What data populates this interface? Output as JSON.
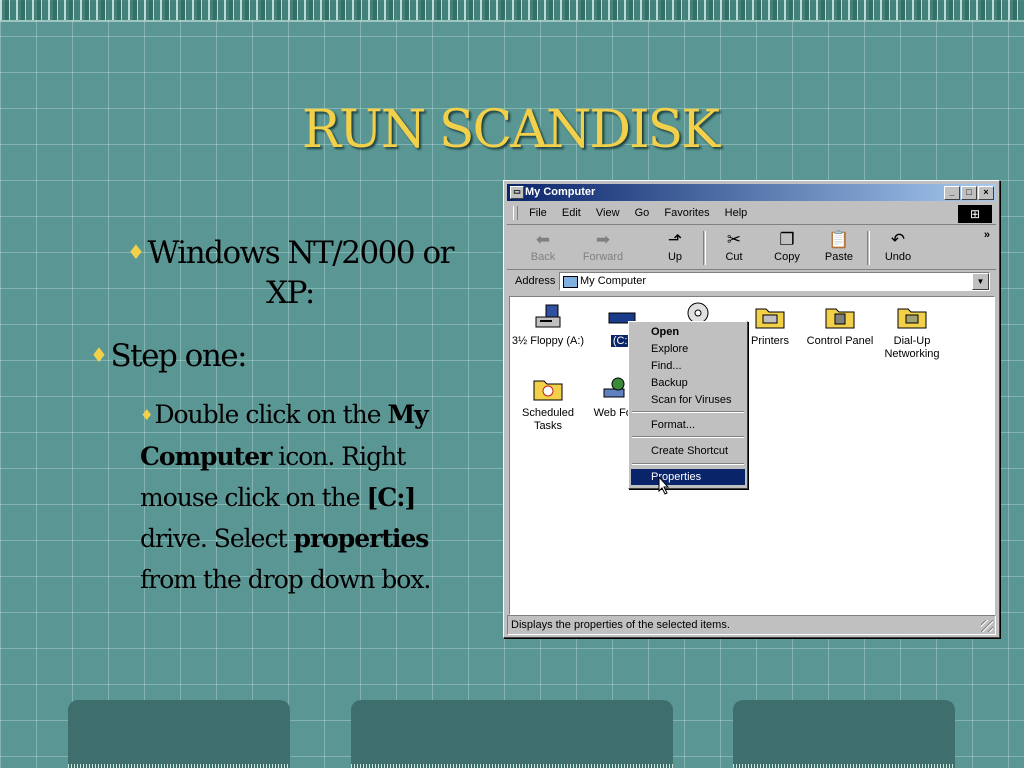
{
  "slide": {
    "title": "RUN SCANDISK",
    "bullet1": "Windows NT/2000 or XP:",
    "bullet2": "Step one:",
    "sub": {
      "p1": "Double click on the ",
      "b1": "My Computer",
      "p2": " icon. Right mouse click on the ",
      "b2": "[C:]",
      "p3": " drive. Select ",
      "b3": "properties",
      "p4": " from the drop down box."
    }
  },
  "window": {
    "title": "My Computer",
    "menu": [
      "File",
      "Edit",
      "View",
      "Go",
      "Favorites",
      "Help"
    ],
    "toolbar": {
      "back": "Back",
      "forward": "Forward",
      "up": "Up",
      "cut": "Cut",
      "copy": "Copy",
      "paste": "Paste",
      "undo": "Undo"
    },
    "address_label": "Address",
    "address_value": "My Computer",
    "items": {
      "floppy": "3½ Floppy (A:)",
      "c_drive": "(C:)",
      "printers": "Printers",
      "control_panel": "Control Panel",
      "dialup": "Dial-Up Networking",
      "scheduled": "Scheduled Tasks",
      "webfolders": "Web Fol"
    },
    "status": "Displays the properties of the selected items."
  },
  "context_menu": {
    "open": "Open",
    "explore": "Explore",
    "find": "Find...",
    "backup": "Backup",
    "scan": "Scan for Viruses",
    "format": "Format...",
    "shortcut": "Create Shortcut",
    "properties": "Properties"
  },
  "colors": {
    "background": "#5a9794",
    "title": "#f2d04a",
    "selection": "#0a246a"
  }
}
